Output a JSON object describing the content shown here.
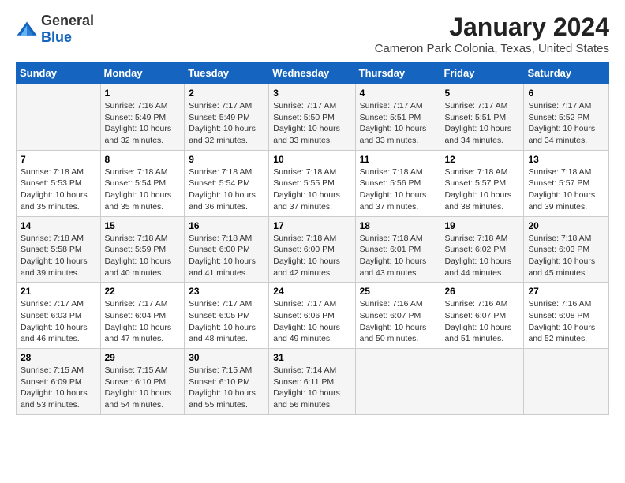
{
  "logo": {
    "general": "General",
    "blue": "Blue"
  },
  "title": "January 2024",
  "subtitle": "Cameron Park Colonia, Texas, United States",
  "headers": [
    "Sunday",
    "Monday",
    "Tuesday",
    "Wednesday",
    "Thursday",
    "Friday",
    "Saturday"
  ],
  "rows": [
    [
      {
        "day": "",
        "sunrise": "",
        "sunset": "",
        "daylight": ""
      },
      {
        "day": "1",
        "sunrise": "Sunrise: 7:16 AM",
        "sunset": "Sunset: 5:49 PM",
        "daylight": "Daylight: 10 hours and 32 minutes."
      },
      {
        "day": "2",
        "sunrise": "Sunrise: 7:17 AM",
        "sunset": "Sunset: 5:49 PM",
        "daylight": "Daylight: 10 hours and 32 minutes."
      },
      {
        "day": "3",
        "sunrise": "Sunrise: 7:17 AM",
        "sunset": "Sunset: 5:50 PM",
        "daylight": "Daylight: 10 hours and 33 minutes."
      },
      {
        "day": "4",
        "sunrise": "Sunrise: 7:17 AM",
        "sunset": "Sunset: 5:51 PM",
        "daylight": "Daylight: 10 hours and 33 minutes."
      },
      {
        "day": "5",
        "sunrise": "Sunrise: 7:17 AM",
        "sunset": "Sunset: 5:51 PM",
        "daylight": "Daylight: 10 hours and 34 minutes."
      },
      {
        "day": "6",
        "sunrise": "Sunrise: 7:17 AM",
        "sunset": "Sunset: 5:52 PM",
        "daylight": "Daylight: 10 hours and 34 minutes."
      }
    ],
    [
      {
        "day": "7",
        "sunrise": "Sunrise: 7:18 AM",
        "sunset": "Sunset: 5:53 PM",
        "daylight": "Daylight: 10 hours and 35 minutes."
      },
      {
        "day": "8",
        "sunrise": "Sunrise: 7:18 AM",
        "sunset": "Sunset: 5:54 PM",
        "daylight": "Daylight: 10 hours and 35 minutes."
      },
      {
        "day": "9",
        "sunrise": "Sunrise: 7:18 AM",
        "sunset": "Sunset: 5:54 PM",
        "daylight": "Daylight: 10 hours and 36 minutes."
      },
      {
        "day": "10",
        "sunrise": "Sunrise: 7:18 AM",
        "sunset": "Sunset: 5:55 PM",
        "daylight": "Daylight: 10 hours and 37 minutes."
      },
      {
        "day": "11",
        "sunrise": "Sunrise: 7:18 AM",
        "sunset": "Sunset: 5:56 PM",
        "daylight": "Daylight: 10 hours and 37 minutes."
      },
      {
        "day": "12",
        "sunrise": "Sunrise: 7:18 AM",
        "sunset": "Sunset: 5:57 PM",
        "daylight": "Daylight: 10 hours and 38 minutes."
      },
      {
        "day": "13",
        "sunrise": "Sunrise: 7:18 AM",
        "sunset": "Sunset: 5:57 PM",
        "daylight": "Daylight: 10 hours and 39 minutes."
      }
    ],
    [
      {
        "day": "14",
        "sunrise": "Sunrise: 7:18 AM",
        "sunset": "Sunset: 5:58 PM",
        "daylight": "Daylight: 10 hours and 39 minutes."
      },
      {
        "day": "15",
        "sunrise": "Sunrise: 7:18 AM",
        "sunset": "Sunset: 5:59 PM",
        "daylight": "Daylight: 10 hours and 40 minutes."
      },
      {
        "day": "16",
        "sunrise": "Sunrise: 7:18 AM",
        "sunset": "Sunset: 6:00 PM",
        "daylight": "Daylight: 10 hours and 41 minutes."
      },
      {
        "day": "17",
        "sunrise": "Sunrise: 7:18 AM",
        "sunset": "Sunset: 6:00 PM",
        "daylight": "Daylight: 10 hours and 42 minutes."
      },
      {
        "day": "18",
        "sunrise": "Sunrise: 7:18 AM",
        "sunset": "Sunset: 6:01 PM",
        "daylight": "Daylight: 10 hours and 43 minutes."
      },
      {
        "day": "19",
        "sunrise": "Sunrise: 7:18 AM",
        "sunset": "Sunset: 6:02 PM",
        "daylight": "Daylight: 10 hours and 44 minutes."
      },
      {
        "day": "20",
        "sunrise": "Sunrise: 7:18 AM",
        "sunset": "Sunset: 6:03 PM",
        "daylight": "Daylight: 10 hours and 45 minutes."
      }
    ],
    [
      {
        "day": "21",
        "sunrise": "Sunrise: 7:17 AM",
        "sunset": "Sunset: 6:03 PM",
        "daylight": "Daylight: 10 hours and 46 minutes."
      },
      {
        "day": "22",
        "sunrise": "Sunrise: 7:17 AM",
        "sunset": "Sunset: 6:04 PM",
        "daylight": "Daylight: 10 hours and 47 minutes."
      },
      {
        "day": "23",
        "sunrise": "Sunrise: 7:17 AM",
        "sunset": "Sunset: 6:05 PM",
        "daylight": "Daylight: 10 hours and 48 minutes."
      },
      {
        "day": "24",
        "sunrise": "Sunrise: 7:17 AM",
        "sunset": "Sunset: 6:06 PM",
        "daylight": "Daylight: 10 hours and 49 minutes."
      },
      {
        "day": "25",
        "sunrise": "Sunrise: 7:16 AM",
        "sunset": "Sunset: 6:07 PM",
        "daylight": "Daylight: 10 hours and 50 minutes."
      },
      {
        "day": "26",
        "sunrise": "Sunrise: 7:16 AM",
        "sunset": "Sunset: 6:07 PM",
        "daylight": "Daylight: 10 hours and 51 minutes."
      },
      {
        "day": "27",
        "sunrise": "Sunrise: 7:16 AM",
        "sunset": "Sunset: 6:08 PM",
        "daylight": "Daylight: 10 hours and 52 minutes."
      }
    ],
    [
      {
        "day": "28",
        "sunrise": "Sunrise: 7:15 AM",
        "sunset": "Sunset: 6:09 PM",
        "daylight": "Daylight: 10 hours and 53 minutes."
      },
      {
        "day": "29",
        "sunrise": "Sunrise: 7:15 AM",
        "sunset": "Sunset: 6:10 PM",
        "daylight": "Daylight: 10 hours and 54 minutes."
      },
      {
        "day": "30",
        "sunrise": "Sunrise: 7:15 AM",
        "sunset": "Sunset: 6:10 PM",
        "daylight": "Daylight: 10 hours and 55 minutes."
      },
      {
        "day": "31",
        "sunrise": "Sunrise: 7:14 AM",
        "sunset": "Sunset: 6:11 PM",
        "daylight": "Daylight: 10 hours and 56 minutes."
      },
      {
        "day": "",
        "sunrise": "",
        "sunset": "",
        "daylight": ""
      },
      {
        "day": "",
        "sunrise": "",
        "sunset": "",
        "daylight": ""
      },
      {
        "day": "",
        "sunrise": "",
        "sunset": "",
        "daylight": ""
      }
    ]
  ]
}
